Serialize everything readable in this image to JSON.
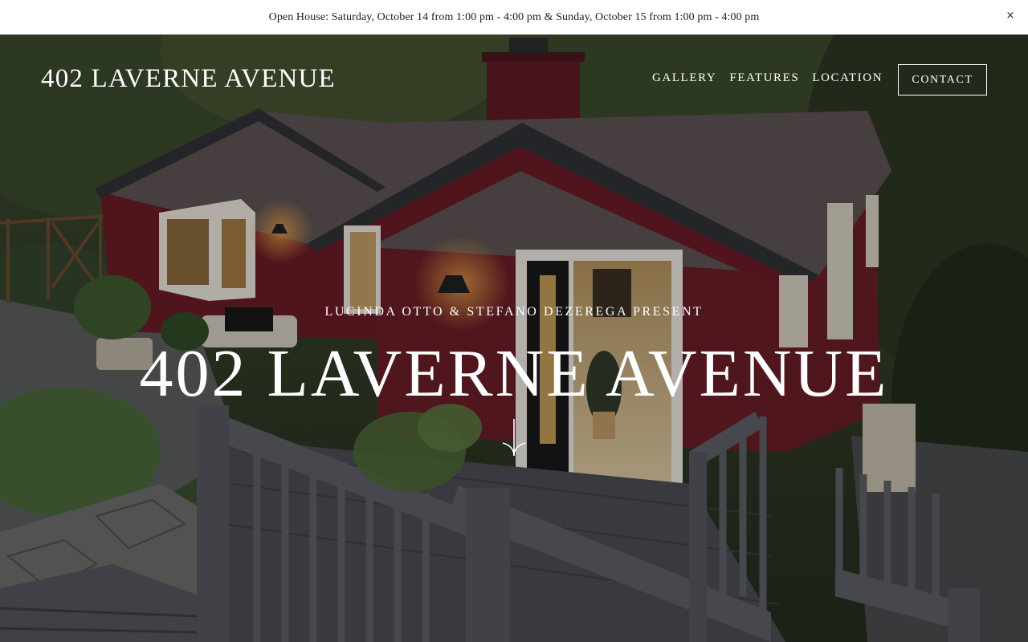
{
  "announcement": {
    "text": "Open House: Saturday, October 14 from 1:00 pm - 4:00 pm & Sunday, October 15 from 1:00 pm - 4:00 pm",
    "close_icon": "×"
  },
  "header": {
    "site_title": "402 LAVERNE AVENUE",
    "nav": [
      "GALLERY",
      "FEATURES",
      "LOCATION"
    ],
    "contact_label": "CONTACT"
  },
  "hero": {
    "eyebrow": "LUCINDA OTTO & STEFANO DEZEREGA PRESENT",
    "title": "402 LAVERNE AVENUE",
    "scroll_icon": "arrow-down-icon"
  },
  "colors": {
    "house_red": "#6b1a22",
    "roof": "#5d5352",
    "deck": "#555860",
    "foliage": "#2e3a22",
    "announcement_bg": "#ffffff"
  }
}
